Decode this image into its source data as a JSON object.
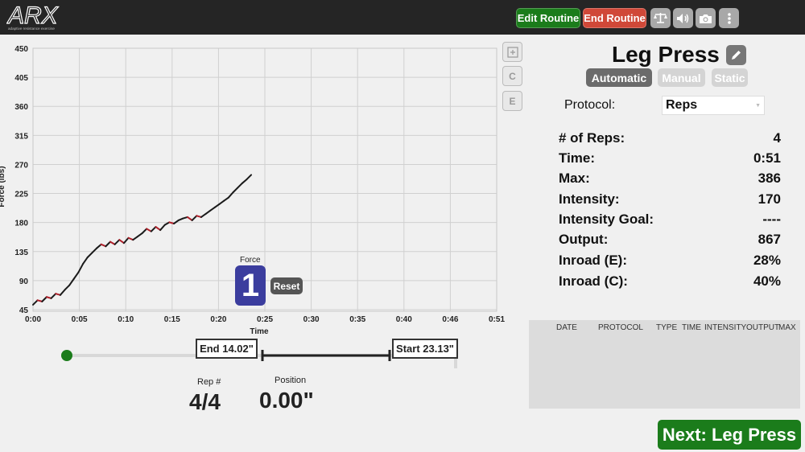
{
  "header": {
    "logo_text": "ARX",
    "logo_tagline": "adaptive resistance exercise",
    "edit_routine_label": "Edit Routine",
    "end_routine_label": "End Routine",
    "icons": [
      "scale-icon",
      "volume-icon",
      "camera-icon",
      "more-vertical-icon"
    ]
  },
  "chart_data": {
    "type": "line",
    "xlabel": "Time",
    "ylabel": "Force (lbs)",
    "x_ticks": [
      "0:00",
      "0:05",
      "0:10",
      "0:15",
      "0:20",
      "0:25",
      "0:30",
      "0:35",
      "0:40",
      "0:46",
      "0:51"
    ],
    "y_ticks": [
      "45",
      "90",
      "135",
      "180",
      "225",
      "270",
      "315",
      "360",
      "405",
      "450"
    ],
    "xlim": [
      0,
      51
    ],
    "ylim": [
      45,
      450
    ],
    "grid": true,
    "colors": {
      "concentric": "#1a1a1a",
      "eccentric": "#b0202a"
    },
    "series": [
      {
        "points": [
          [
            0,
            55
          ],
          [
            0.5,
            62
          ],
          [
            1,
            60
          ],
          [
            1.5,
            67
          ],
          [
            2,
            65
          ],
          [
            2.5,
            72
          ],
          [
            3,
            70
          ],
          [
            3.5,
            78
          ],
          [
            4,
            85
          ],
          [
            4.5,
            95
          ],
          [
            5,
            105
          ],
          [
            5.5,
            118
          ],
          [
            6,
            128
          ],
          [
            6.5,
            135
          ],
          [
            7,
            142
          ],
          [
            7.5,
            148
          ],
          [
            8,
            145
          ],
          [
            8.5,
            152
          ],
          [
            9,
            148
          ],
          [
            9.5,
            155
          ],
          [
            10,
            150
          ],
          [
            10.5,
            158
          ],
          [
            11,
            155
          ],
          [
            11.5,
            160
          ],
          [
            12,
            165
          ],
          [
            12.5,
            172
          ],
          [
            13,
            168
          ],
          [
            13.5,
            175
          ],
          [
            14,
            170
          ],
          [
            14.5,
            178
          ],
          [
            15,
            182
          ],
          [
            15.5,
            180
          ],
          [
            16,
            185
          ],
          [
            16.5,
            188
          ],
          [
            17,
            190
          ],
          [
            17.5,
            185
          ],
          [
            18,
            192
          ],
          [
            18.5,
            190
          ],
          [
            19,
            195
          ],
          [
            19.5,
            200
          ],
          [
            20,
            205
          ],
          [
            20.5,
            210
          ],
          [
            21,
            215
          ],
          [
            21.5,
            220
          ],
          [
            22,
            228
          ],
          [
            22.5,
            235
          ],
          [
            23,
            242
          ],
          [
            23.5,
            248
          ],
          [
            24,
            255
          ]
        ]
      }
    ]
  },
  "chart_buttons": {
    "zoom_label": "+",
    "c_label": "C",
    "e_label": "E"
  },
  "force": {
    "label": "Force",
    "value": "1",
    "reset_label": "Reset"
  },
  "range": {
    "end_label": "End 14.02\"",
    "start_label": "Start 23.13\""
  },
  "rep": {
    "label": "Rep #",
    "value": "4/4"
  },
  "position": {
    "label": "Position",
    "value": "0.00\""
  },
  "exercise": {
    "title": "Leg Press",
    "modes": [
      "Automatic",
      "Manual",
      "Static"
    ],
    "active_mode": "Automatic",
    "protocol_label": "Protocol:",
    "protocol_value": "Reps"
  },
  "metrics": [
    {
      "label": "# of Reps:",
      "value": "4"
    },
    {
      "label": "Time:",
      "value": "0:51"
    },
    {
      "label": "Max:",
      "value": "386"
    },
    {
      "label": "Intensity:",
      "value": "170"
    },
    {
      "label": "Intensity Goal:",
      "value": "----"
    },
    {
      "label": "Output:",
      "value": "867"
    },
    {
      "label": "Inroad (E):",
      "value": "28%"
    },
    {
      "label": "Inroad (C):",
      "value": "40%"
    }
  ],
  "history": {
    "columns": [
      "DATE",
      "PROTOCOL",
      "TYPE",
      "TIME",
      "INTENSITY",
      "OUTPUT",
      "MAX"
    ]
  },
  "next_label": "Next: Leg Press"
}
